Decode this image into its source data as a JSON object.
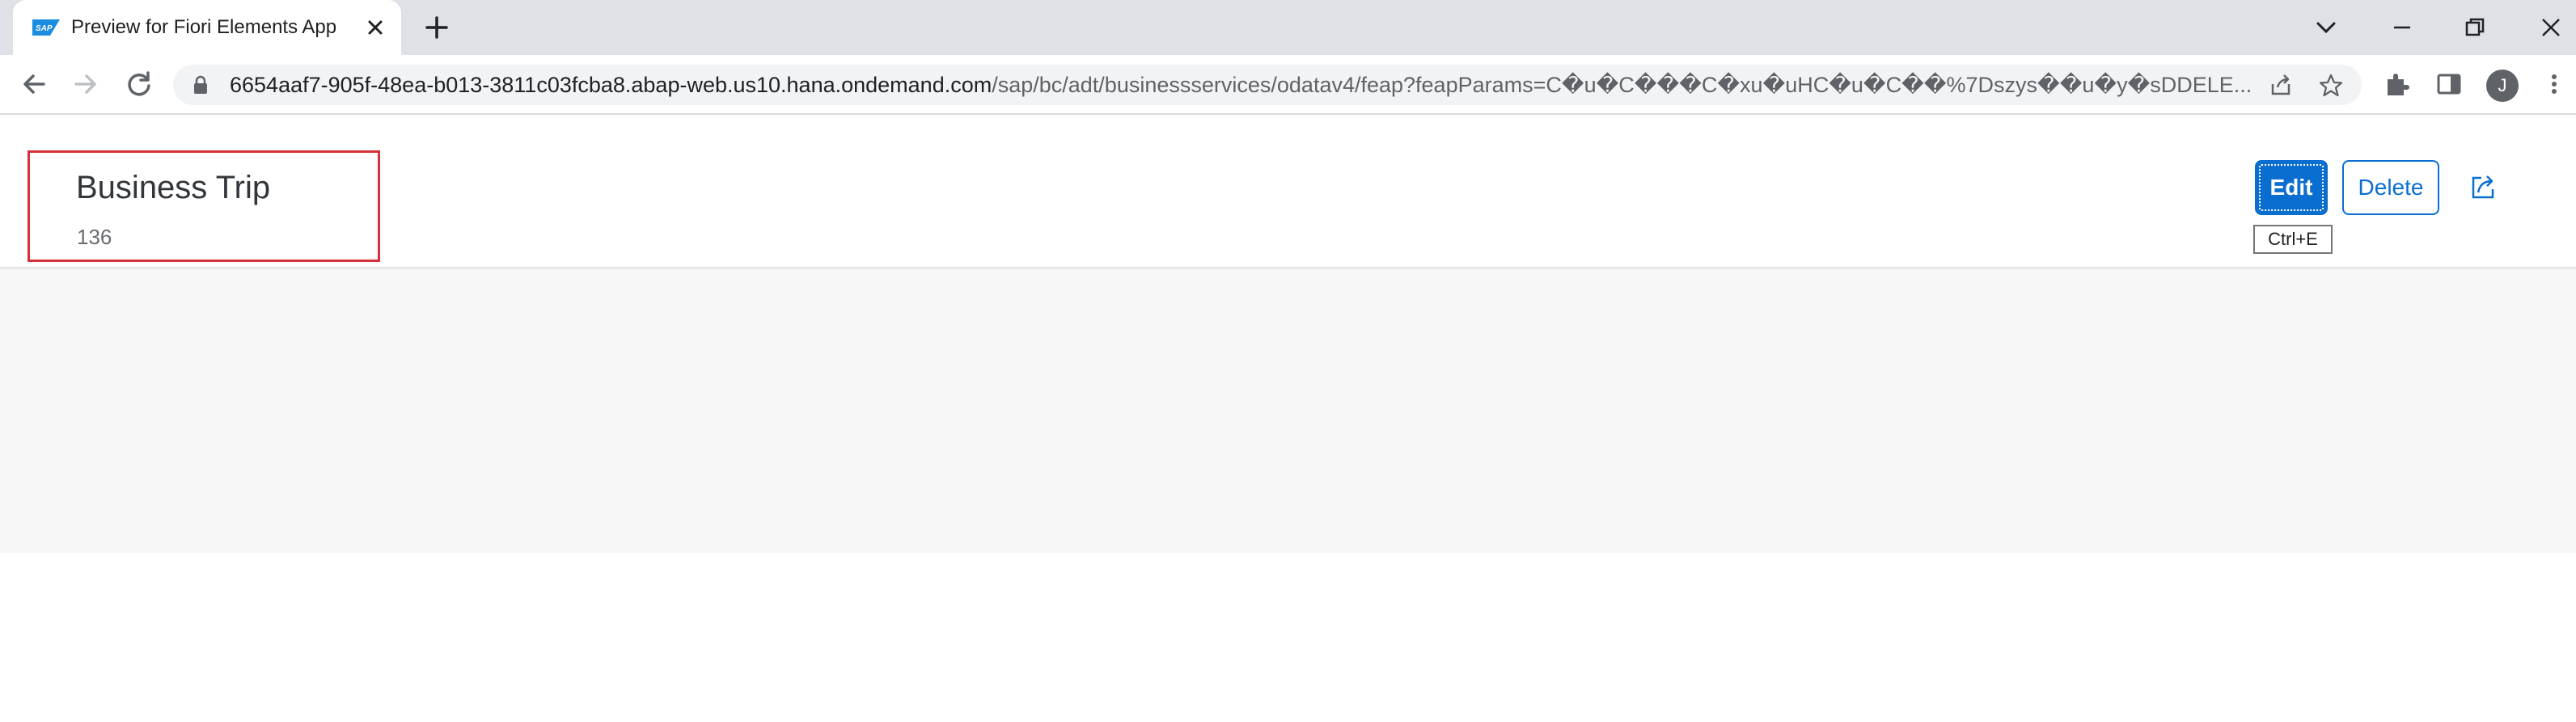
{
  "browser": {
    "tab_title": "Preview for Fiori Elements App",
    "url_host": "6654aaf7-905f-48ea-b013-3811c03fcba8.abap-web.us10.hana.ondemand.com",
    "url_path": "/sap/bc/adt/businessservices/odatav4/feap?feapParams=C�u�C���C�xu�uHC�u�C��%7Dszys��u�y�sDDELE...",
    "profile_initial": "J",
    "accent_color": "#0a6ed1"
  },
  "object_page": {
    "title": "Business Trip",
    "subtitle": "136",
    "actions": {
      "edit_label": "Edit",
      "delete_label": "Delete",
      "edit_tooltip": "Ctrl+E"
    },
    "highlight_color": "#d6313a"
  },
  "icons": [
    "sap-logo-icon",
    "close-icon",
    "plus-icon",
    "chevron-down-icon",
    "minimize-icon",
    "restore-icon",
    "close-window-icon",
    "back-arrow-icon",
    "forward-arrow-icon",
    "reload-icon",
    "lock-icon",
    "share-icon",
    "star-icon",
    "extensions-icon",
    "side-panel-icon",
    "avatar",
    "more-vert-icon",
    "open-in-new-icon"
  ]
}
